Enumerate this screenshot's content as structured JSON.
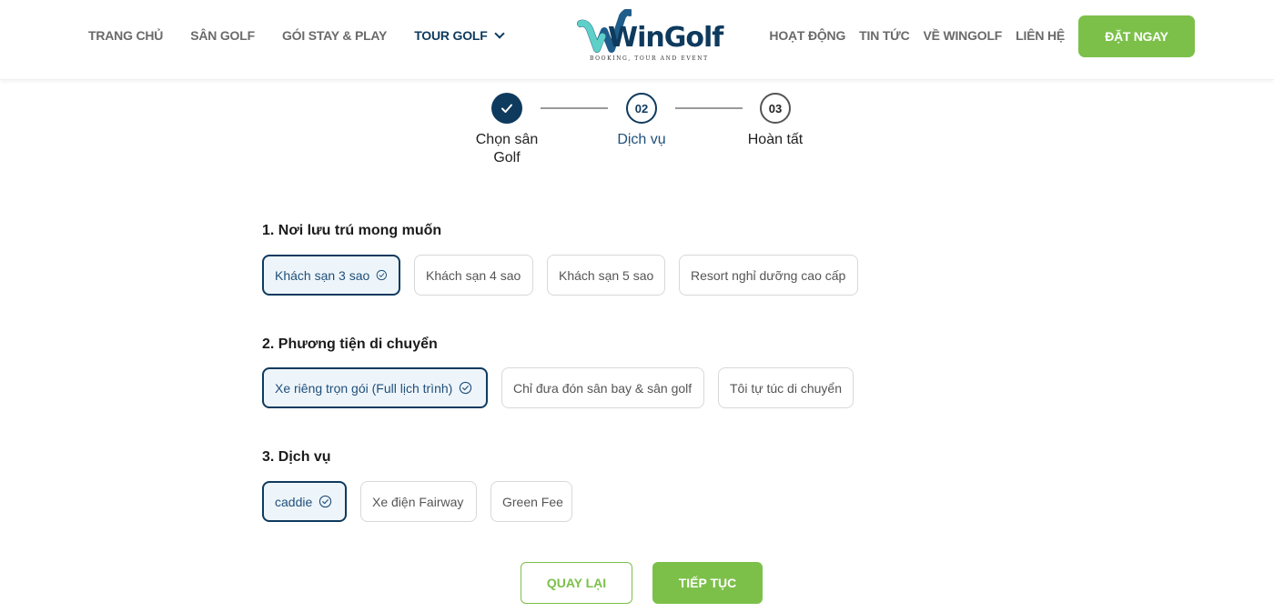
{
  "colors": {
    "primary": "#0e3a5e",
    "accent_green": "#7cc04a",
    "selected_bg": "#eef5fa",
    "border": "#d8d8d8",
    "nav_text": "#6a6a6a"
  },
  "header": {
    "nav_left": [
      {
        "label": "TRANG CHỦ"
      },
      {
        "label": "SÂN GOLF"
      },
      {
        "label": "GÓI STAY & PLAY"
      }
    ],
    "nav_dropdown": {
      "label": "TOUR GOLF",
      "icon": "chevron-down-icon"
    },
    "logo": {
      "text": "WinGolf",
      "tagline": "BOOKING, TOUR AND EVENT"
    },
    "nav_right": [
      {
        "label": "HOẠT ĐỘNG"
      },
      {
        "label": "TIN TỨC"
      },
      {
        "label": "VỀ WINGOLF"
      },
      {
        "label": "LIÊN HỆ"
      }
    ],
    "cta_label": "ĐẶT NGAY"
  },
  "stepper": {
    "steps": [
      {
        "number": "",
        "label": "Chọn sân Golf",
        "state": "done",
        "icon": "check-icon"
      },
      {
        "number": "02",
        "label": "Dịch vụ",
        "state": "current"
      },
      {
        "number": "03",
        "label": "Hoàn tất",
        "state": "upcoming"
      }
    ]
  },
  "sections": [
    {
      "title": "1. Nơi lưu trú mong muốn",
      "options": [
        {
          "label": "Khách sạn 3 sao",
          "selected": true
        },
        {
          "label": "Khách sạn 4 sao",
          "selected": false
        },
        {
          "label": "Khách sạn 5 sao",
          "selected": false
        },
        {
          "label": "Resort nghỉ dưỡng cao cấp",
          "selected": false
        }
      ]
    },
    {
      "title": "2. Phương tiện di chuyển",
      "options": [
        {
          "label": "Xe riêng trọn gói (Full lịch trình)",
          "selected": true
        },
        {
          "label": "Chỉ đưa đón sân bay & sân golf",
          "selected": false
        },
        {
          "label": "Tôi tự túc di chuyển",
          "selected": false
        }
      ]
    },
    {
      "title": "3. Dịch vụ",
      "options": [
        {
          "label": "caddie",
          "selected": true
        },
        {
          "label": "Xe điện Fairway",
          "selected": false
        },
        {
          "label": "Green Fee",
          "selected": false
        }
      ]
    }
  ],
  "actions": {
    "back_label": "QUAY LẠI",
    "next_label": "TIẾP TỤC"
  }
}
